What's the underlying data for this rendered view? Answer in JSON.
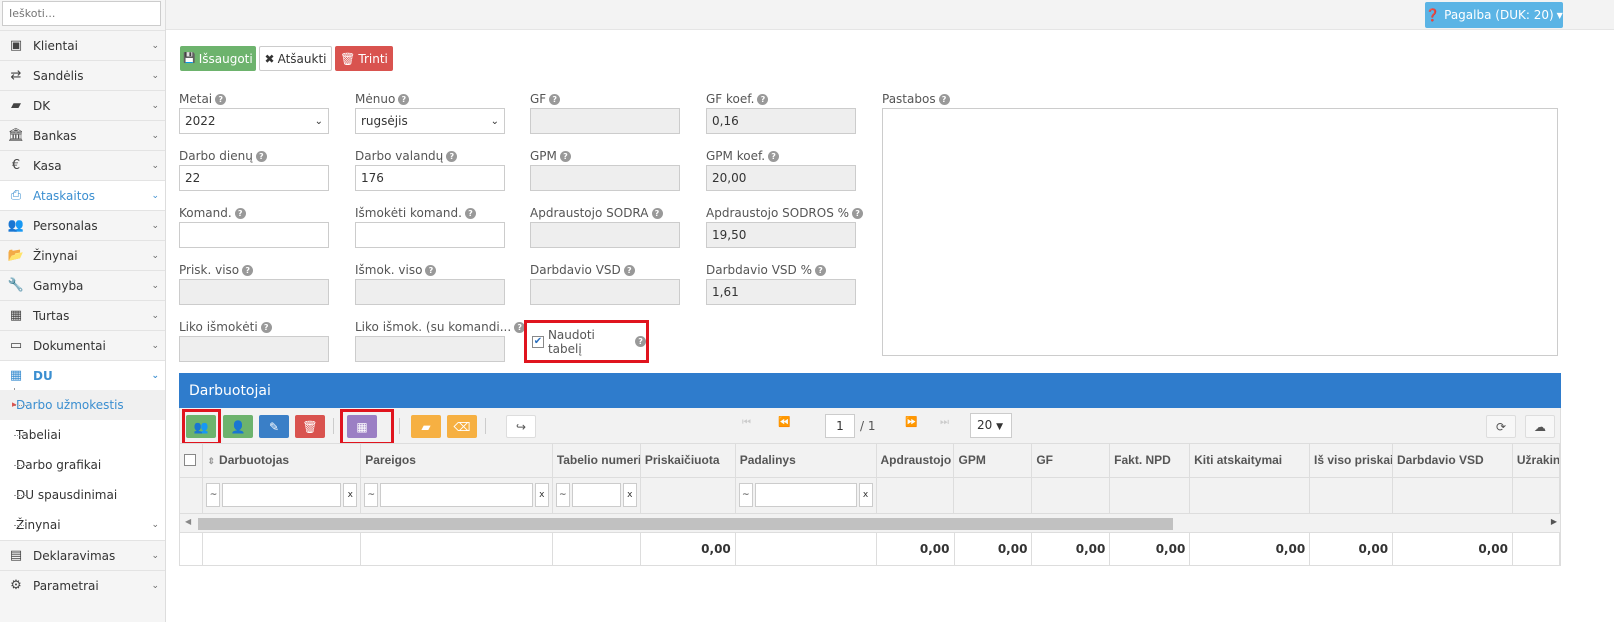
{
  "search": {
    "placeholder": "Ieškoti..."
  },
  "sidebar": {
    "items": [
      {
        "label": "Klientai",
        "icon": "address-book-icon",
        "g": "▣"
      },
      {
        "label": "Sandėlis",
        "icon": "exchange-icon",
        "g": "⇄"
      },
      {
        "label": "DK",
        "icon": "book-icon",
        "g": "▰"
      },
      {
        "label": "Bankas",
        "icon": "bank-icon",
        "g": "🏛"
      },
      {
        "label": "Kasa",
        "icon": "euro-icon",
        "g": "€"
      },
      {
        "label": "Ataskaitos",
        "icon": "print-icon",
        "g": "⎙",
        "active": true
      },
      {
        "label": "Personalas",
        "icon": "users-icon",
        "g": "👥"
      },
      {
        "label": "Žinynai",
        "icon": "folder-open-icon",
        "g": "📂"
      },
      {
        "label": "Gamyba",
        "icon": "wrench-icon",
        "g": "🔧"
      },
      {
        "label": "Turtas",
        "icon": "cube-icon",
        "g": "▦"
      },
      {
        "label": "Dokumentai",
        "icon": "inbox-icon",
        "g": "▭"
      },
      {
        "label": "DU",
        "icon": "table-icon",
        "g": "▦",
        "du": true
      }
    ],
    "du_sub": [
      "Darbo užmokestis",
      "Tabeliai",
      "Darbo grafikai",
      "DU spausdinimai",
      "Žinynai"
    ],
    "bottom": [
      {
        "label": "Deklaravimas",
        "icon": "file-icon",
        "g": "▤"
      },
      {
        "label": "Parametrai",
        "icon": "cogs-icon",
        "g": "⚙"
      }
    ]
  },
  "help": {
    "label": "Pagalba (DUK: 20)"
  },
  "actions": {
    "save": "Išsaugoti",
    "cancel": "Atšaukti",
    "delete": "Trinti"
  },
  "form": [
    {
      "label": "Metai",
      "value": "2022",
      "select": true
    },
    {
      "label": "Mėnuo",
      "value": "rugsėjis",
      "select": true
    },
    {
      "label": "GF",
      "value": "",
      "ro": true
    },
    {
      "label": "GF koef.",
      "value": "0,16",
      "ro": true
    },
    {
      "label": "Darbo dienų",
      "value": "22"
    },
    {
      "label": "Darbo valandų",
      "value": "176"
    },
    {
      "label": "GPM",
      "value": "",
      "ro": true
    },
    {
      "label": "GPM koef.",
      "value": "20,00",
      "ro": true
    },
    {
      "label": "Komand.",
      "value": ""
    },
    {
      "label": "Išmokėti komand.",
      "value": ""
    },
    {
      "label": "Apdraustojo SODRA",
      "value": "",
      "ro": true
    },
    {
      "label": "Apdraustojo SODROS %",
      "value": "19,50",
      "ro": true
    },
    {
      "label": "Prisk. viso",
      "value": "",
      "ro": true
    },
    {
      "label": "Išmok. viso",
      "value": "",
      "ro": true
    },
    {
      "label": "Darbdavio VSD",
      "value": "",
      "ro": true
    },
    {
      "label": "Darbdavio VSD %",
      "value": "1,61",
      "ro": true
    },
    {
      "label": "Liko išmokėti",
      "value": "",
      "ro": true
    },
    {
      "label": "Liko išmok. (su komandi...",
      "value": "",
      "ro": true
    }
  ],
  "notes": {
    "label": "Pastabos"
  },
  "use_timesheet": {
    "label": "Naudoti tabelį",
    "checked": true
  },
  "panel": {
    "title": "Darbuotojai"
  },
  "pager": {
    "page": "1",
    "total": "/ 1",
    "size": "20"
  },
  "grid": {
    "columns": [
      "",
      "Darbuotojas",
      "Pareigos",
      "Tabelio numeris",
      "Priskaičiuota",
      "Padalinys",
      "Apdraustojo",
      "GPM",
      "GF",
      "Fakt. NPD",
      "Kiti atskaitymai",
      "Iš viso priskaičiuota",
      "Darbdavio VSD",
      "Užrakinta"
    ],
    "filters": [
      false,
      true,
      true,
      true,
      false,
      true,
      false,
      false,
      false,
      false,
      false,
      false,
      false,
      false
    ],
    "totals": [
      "",
      "",
      "",
      "",
      "0,00",
      "",
      "0,00",
      "0,00",
      "0,00",
      "0,00",
      "0,00",
      "0,00",
      "0,00",
      ""
    ]
  },
  "colors": {
    "primary": "#2f7ccc",
    "success": "#6db36d",
    "danger": "#d9534f",
    "purple": "#9b7fc4",
    "warning": "#f6b042",
    "highlight": "#e0141e"
  }
}
